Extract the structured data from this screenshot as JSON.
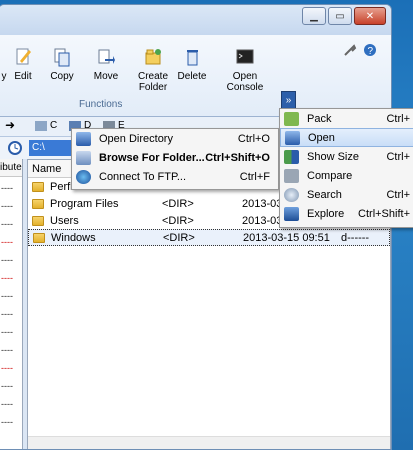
{
  "ribbon": {
    "items": [
      {
        "label": "y",
        "icon": "partial-icon"
      },
      {
        "label": "Edit",
        "icon": "edit-icon"
      },
      {
        "label": "Copy",
        "icon": "copy-icon"
      },
      {
        "label": "Move",
        "icon": "move-icon"
      },
      {
        "label": "Create\nFolder",
        "icon": "create-folder-icon"
      },
      {
        "label": "Delete",
        "icon": "delete-icon"
      },
      {
        "label": "Open\nConsole",
        "icon": "console-icon"
      }
    ],
    "group_label": "Functions"
  },
  "drives": [
    {
      "label": "C"
    },
    {
      "label": "D"
    },
    {
      "label": "E"
    }
  ],
  "path": {
    "value": "C:\\"
  },
  "left_panel": {
    "header": "ibute",
    "rows": [
      "----",
      "----",
      "----",
      "----",
      "----",
      "----",
      "----",
      "----",
      "----",
      "----",
      "----",
      "----",
      "----",
      "----",
      "----"
    ]
  },
  "file_panel": {
    "header_name": "Name",
    "rows": [
      {
        "name": "Perfl",
        "type": "",
        "date": "",
        "attr": ""
      },
      {
        "name": "Program Files",
        "type": "<DIR>",
        "date": "2013-03",
        "attr": ""
      },
      {
        "name": "Users",
        "type": "<DIR>",
        "date": "2013-03",
        "attr": ""
      },
      {
        "name": "Windows",
        "type": "<DIR>",
        "date": "2013-03-15 09:51",
        "attr": "d------"
      }
    ]
  },
  "context_menu": {
    "items": [
      {
        "label": "Open Directory",
        "shortcut": "Ctrl+O"
      },
      {
        "label": "Browse For Folder...",
        "shortcut": "Ctrl+Shift+O"
      },
      {
        "label": "Connect To FTP...",
        "shortcut": "Ctrl+F"
      }
    ]
  },
  "side_menu": {
    "items": [
      {
        "label": "Pack",
        "shortcut": "Ctrl+"
      },
      {
        "label": "Open",
        "shortcut": ""
      },
      {
        "label": "Show Size",
        "shortcut": "Ctrl+"
      },
      {
        "label": "Compare",
        "shortcut": ""
      },
      {
        "label": "Search",
        "shortcut": "Ctrl+"
      },
      {
        "label": "Explore",
        "shortcut": "Ctrl+Shift+"
      }
    ]
  },
  "expand_button": "»"
}
